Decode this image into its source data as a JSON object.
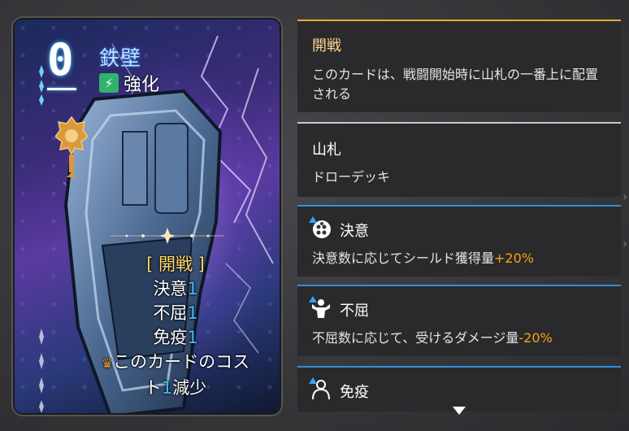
{
  "card": {
    "cost": "0",
    "name": "鉄壁",
    "type_label": "強化",
    "type_icon": "lightning-icon",
    "effect": {
      "keyword_header": "[ 開戦 ]",
      "lines": [
        {
          "pre": "決意",
          "num": "1",
          "post": ""
        },
        {
          "pre": "不屈",
          "num": "1",
          "post": ""
        },
        {
          "pre": "免疫",
          "num": "1",
          "post": ""
        },
        {
          "pre": "このカードのコス",
          "num": "",
          "post": ""
        },
        {
          "pre": "ト",
          "num": "1",
          "post": "減少"
        }
      ]
    }
  },
  "panels": [
    {
      "title": "開戦",
      "desc": "このカードは、戦闘開始時に山札の一番上に配置される",
      "style": "gold"
    },
    {
      "title": "山札",
      "desc": "ドローデッキ",
      "style": "plain"
    },
    {
      "title": "決意",
      "desc_pre": "決意数に応じてシールド獲得量",
      "desc_val": "+20%",
      "icon": "resolve-icon",
      "style": "blue"
    },
    {
      "title": "不屈",
      "desc_pre": "不屈数に応じて、受けるダメージ量",
      "desc_val": "-20%",
      "icon": "muscle-icon",
      "style": "blue"
    },
    {
      "title": "免疫",
      "desc_pre": "",
      "desc_val": "",
      "icon": "person-icon",
      "style": "blue"
    }
  ],
  "colors": {
    "panel_bg": "#2a2a2c",
    "gold_accent": "#e4ac3a",
    "blue_accent": "#2f8fe0",
    "percent": "#f4a21a",
    "number_highlight": "#3cc0ff"
  }
}
